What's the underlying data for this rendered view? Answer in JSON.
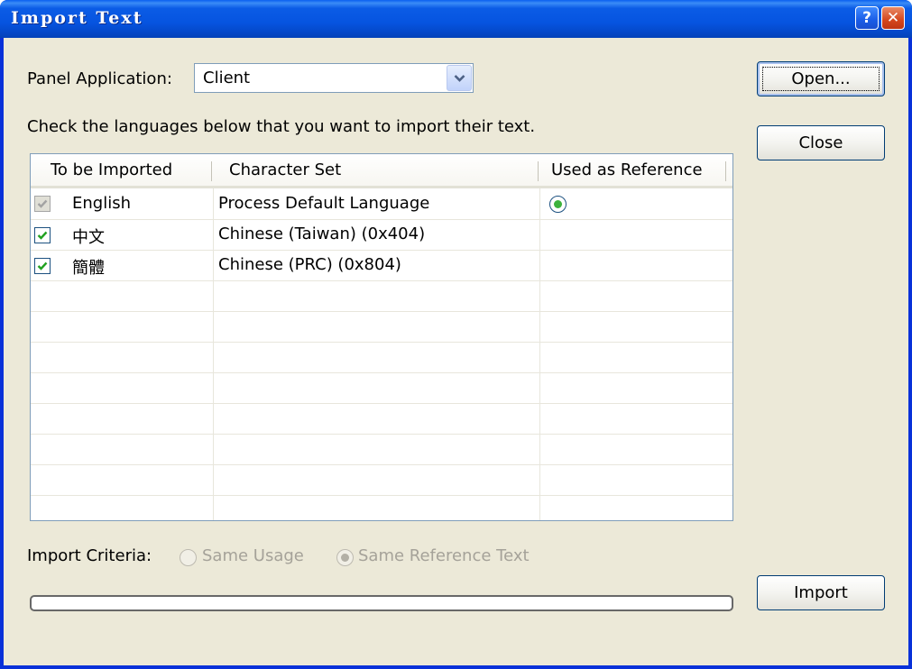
{
  "window": {
    "title": "Import Text",
    "help_glyph": "?",
    "close_glyph": "✕"
  },
  "panel_application": {
    "label": "Panel Application:",
    "value": "Client"
  },
  "instructions": "Check the languages below that you want to import their text.",
  "buttons": {
    "open": "Open...",
    "close": "Close",
    "import": "Import"
  },
  "table": {
    "columns": [
      "To be Imported",
      "Character Set",
      "Used as Reference"
    ],
    "rows": [
      {
        "language": "English",
        "charset": "Process Default Language",
        "checked": true,
        "disabled": true,
        "reference": true
      },
      {
        "language": "中文",
        "charset": "Chinese (Taiwan) (0x404)",
        "checked": true,
        "disabled": false,
        "reference": false
      },
      {
        "language": "簡體",
        "charset": "Chinese (PRC) (0x804)",
        "checked": true,
        "disabled": false,
        "reference": false
      }
    ]
  },
  "import_criteria": {
    "label": "Import Criteria:",
    "options": [
      {
        "label": "Same Usage",
        "selected": false
      },
      {
        "label": "Same Reference Text",
        "selected": true
      }
    ]
  },
  "progress": {
    "value": 0
  },
  "colors": {
    "title_bar": "#0054e3",
    "dialog_bg": "#ece9d8",
    "check_green": "#21a121",
    "radio_green": "#3cb23c"
  }
}
